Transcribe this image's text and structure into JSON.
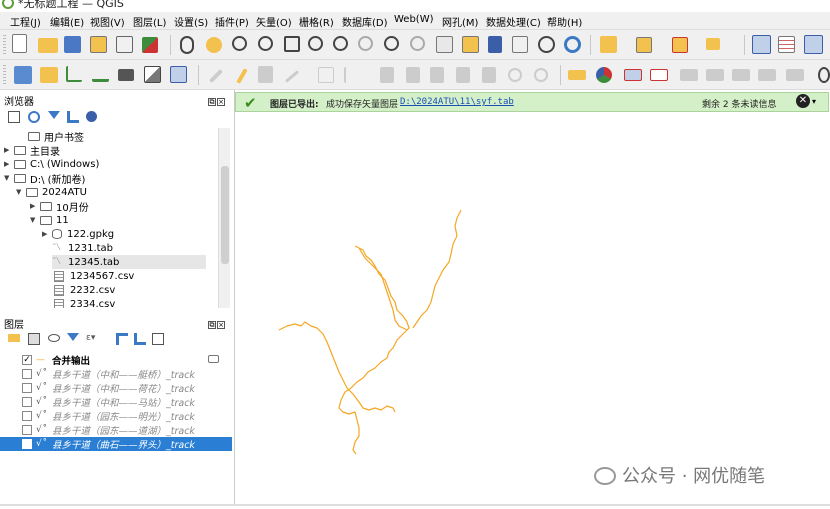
{
  "window": {
    "title": "*无标题工程 — QGIS"
  },
  "menu": [
    "工程(J)",
    "编辑(E)",
    "视图(V)",
    "图层(L)",
    "设置(S)",
    "插件(P)",
    "矢量(O)",
    "栅格(R)",
    "数据库(D)",
    "Web(W)",
    "网孔(M)",
    "数据处理(C)",
    "帮助(H)"
  ],
  "browser": {
    "title": "浏览器",
    "items": [
      {
        "label": "用户书签"
      },
      {
        "label": "主目录"
      },
      {
        "label": "C:\\ (Windows)"
      },
      {
        "label": "D:\\ (新加卷)"
      },
      {
        "label": "2024ATU"
      },
      {
        "label": "10月份"
      },
      {
        "label": "11"
      },
      {
        "label": "122.gpkg"
      },
      {
        "label": "1231.tab"
      },
      {
        "label": "12345.tab"
      },
      {
        "label": "1234567.csv"
      },
      {
        "label": "2232.csv"
      },
      {
        "label": "2334.csv"
      }
    ]
  },
  "layers": {
    "title": "图层",
    "items": [
      {
        "label": "合并输出",
        "checked": true
      },
      {
        "label": "县乡干道（中和——艇桥）_track",
        "checked": false
      },
      {
        "label": "县乡干道（中和——荷花）_track",
        "checked": false
      },
      {
        "label": "县乡干道（中和——马站）_track",
        "checked": false
      },
      {
        "label": "县乡干道（园东——明光）_track",
        "checked": false
      },
      {
        "label": "县乡干道（园东——道湖）_track",
        "checked": false
      },
      {
        "label": "县乡干道（曲石——界头）_track",
        "checked": false
      }
    ]
  },
  "message": {
    "title": "图层已导出:",
    "text": "成功保存矢量图层",
    "link": "D:\\2024ATU\\11\\syf.tab",
    "remaining": "剩余 2 条未读信息"
  },
  "map": {
    "line_color": "#f5a623"
  },
  "watermark": "公众号 · 网优随笔",
  "colors": {
    "selection": "#2a7fd4",
    "message_bg": "#d4f0c8",
    "toolbar_bg": "#f0f0f0"
  }
}
